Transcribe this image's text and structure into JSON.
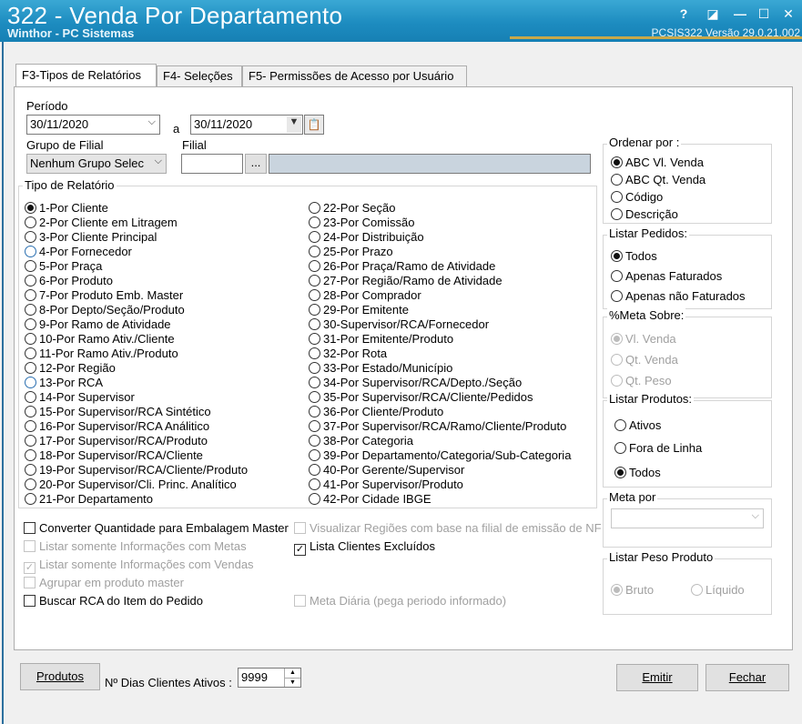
{
  "window": {
    "title": "322 - Venda Por Departamento",
    "subtitle": "Winthor - PC Sistemas",
    "version": "PCSIS322  Versão  29.0.21.002",
    "controls": {
      "help": "?",
      "minimize": "—",
      "maximize": "☐",
      "close": "✕",
      "restore": "◪"
    }
  },
  "tabs": [
    {
      "label": "F3-Tipos de Relatórios"
    },
    {
      "label": "F4- Seleções"
    },
    {
      "label": "F5- Permissões de Acesso por Usuário"
    }
  ],
  "periodo": {
    "label": "Período",
    "start": "30/11/2020",
    "sep": "a",
    "end": "30/11/2020"
  },
  "grupo_filial": {
    "label": "Grupo de Filial",
    "value": "Nenhum Grupo Selec"
  },
  "filial": {
    "label": "Filial",
    "code": "",
    "browse": "...",
    "name": ""
  },
  "tipo_relatorio": {
    "label": "Tipo de Relatório",
    "left": [
      "1-Por Cliente",
      "2-Por Cliente em Litragem",
      "3-Por Cliente Principal",
      "4-Por Fornecedor",
      "5-Por Praça",
      "6-Por Produto",
      "7-Por Produto Emb. Master",
      "8-Por Depto/Seção/Produto",
      "9-Por Ramo de Atividade",
      "10-Por Ramo Ativ./Cliente",
      "11-Por Ramo Ativ./Produto",
      "12-Por Região",
      "13-Por RCA",
      "14-Por Supervisor",
      "15-Por Supervisor/RCA Sintético",
      "16-Por Supervisor/RCA Análitico",
      "17-Por Supervisor/RCA/Produto",
      "18-Por Supervisor/RCA/Cliente",
      "19-Por Supervisor/RCA/Cliente/Produto",
      "20-Por Supervisor/Cli. Princ. Analítico",
      "21-Por Departamento"
    ],
    "right": [
      "22-Por Seção",
      "23-Por Comissão",
      "24-Por Distribuição",
      "25-Por Prazo",
      "26-Por Praça/Ramo de Atividade",
      "27-Por Região/Ramo de Atividade",
      "28-Por Comprador",
      "29-Por Emitente",
      "30-Supervisor/RCA/Fornecedor",
      "31-Por Emitente/Produto",
      "32-Por Rota",
      "33-Por Estado/Município",
      "34-Por Supervisor/RCA/Depto./Seção",
      "35-Por Supervisor/RCA/Cliente/Pedidos",
      "36-Por Cliente/Produto",
      "37-Por Supervisor/RCA/Ramo/Cliente/Produto",
      "38-Por Categoria",
      "39-Por Departamento/Categoria/Sub-Categoria",
      "40-Por Gerente/Supervisor",
      "41-Por Supervisor/Produto",
      "42-Por Cidade IBGE"
    ],
    "selected": "1-Por Cliente"
  },
  "options": {
    "converter": "Converter Quantidade para Embalagem Master",
    "listar_metas": "Listar somente Informações com Metas",
    "listar_vendas": "Listar somente Informações com Vendas",
    "agrupar": "Agrupar em produto master",
    "buscar_rca": "Buscar RCA do Item do Pedido",
    "visualizar_regioes": "Visualizar Regiões com base na filial de emissão de NF",
    "lista_excluidos": "Lista Clientes Excluídos",
    "meta_diaria": "Meta Diária (pega periodo informado)"
  },
  "ordenar": {
    "label": "Ordenar por :",
    "items": [
      "ABC Vl. Venda",
      "ABC Qt. Venda",
      "Código",
      "Descrição"
    ]
  },
  "listar_pedidos": {
    "label": "Listar Pedidos:",
    "items": [
      "Todos",
      "Apenas Faturados",
      "Apenas não Faturados"
    ]
  },
  "meta_sobre": {
    "label": "%Meta Sobre:",
    "items": [
      "Vl. Venda",
      "Qt. Venda",
      "Qt. Peso"
    ]
  },
  "listar_produtos": {
    "label": "Listar Produtos:",
    "items": [
      "Ativos",
      "Fora de Linha",
      "Todos"
    ]
  },
  "meta_por": {
    "label": "Meta por",
    "value": ""
  },
  "listar_peso": {
    "label": "Listar Peso Produto",
    "items": [
      "Bruto",
      "Líquido"
    ]
  },
  "bottom": {
    "produtos": "Produtos",
    "dias_label": "Nº Dias Clientes Ativos :",
    "dias_value": "9999",
    "emitir": "Emitir",
    "fechar": "Fechar"
  }
}
